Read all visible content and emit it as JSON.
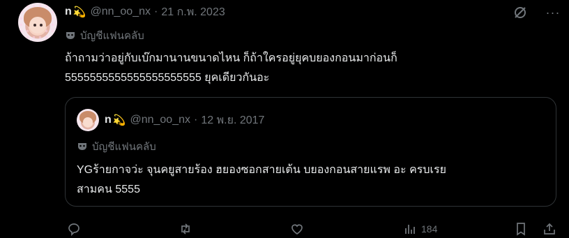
{
  "tweet": {
    "display_name": "n",
    "emoji": "💫",
    "handle": "@nn_oo_nx",
    "separator": "·",
    "date": "21 ก.พ. 2023",
    "fan_label": "บัญชีแฟนคลับ",
    "text_line1": "ถ้าถามว่าอยู่กับเบ๊กมานานขนาดไหน ก็ถ้าใครอยู่ยุคบยองกอนมาก่อนก็",
    "text_line2": "5555555555555555555555 ยุคเดียวกันอะ"
  },
  "quote": {
    "display_name": "n",
    "emoji": "💫",
    "handle": "@nn_oo_nx",
    "separator": "·",
    "date": "12 พ.ย. 2017",
    "fan_label": "บัญชีแฟนคลับ",
    "text_line1": "YGร้ายกาจว่ะ จุนคยูสายร้อง ฮยองซอกสายเต้น บยองกอนสายแรพ อะ ครบเรย",
    "text_line2": "สามคน 5555"
  },
  "actions": {
    "views": "184"
  },
  "icons": [
    "grok-icon",
    "more-icon",
    "mask-icon",
    "reply-icon",
    "retweet-icon",
    "like-icon",
    "views-icon",
    "bookmark-icon",
    "share-icon"
  ]
}
